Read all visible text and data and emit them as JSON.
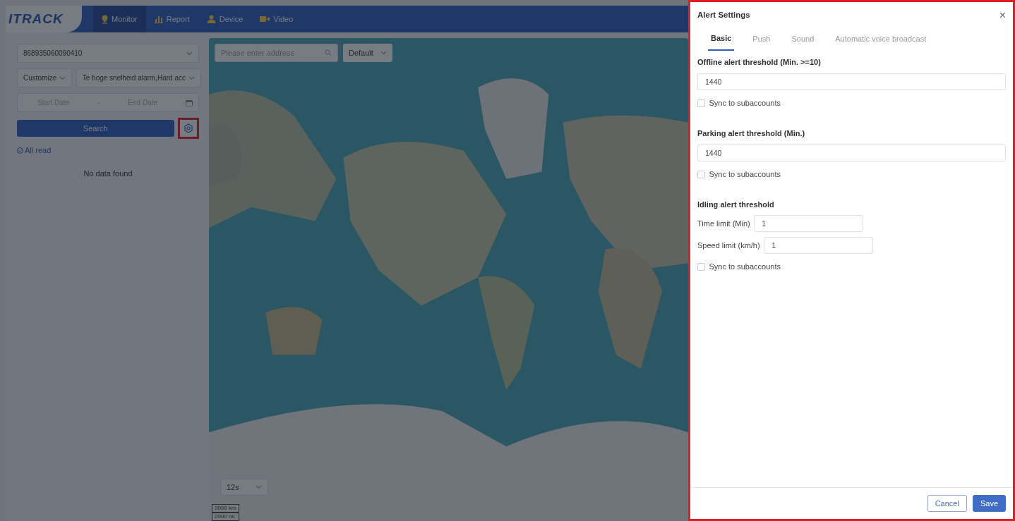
{
  "header": {
    "logo": "ITRACK",
    "nav": [
      {
        "label": "Monitor",
        "selected": true
      },
      {
        "label": "Report",
        "selected": false
      },
      {
        "label": "Device",
        "selected": false
      },
      {
        "label": "Video",
        "selected": false
      }
    ]
  },
  "sidebar": {
    "device": "868935060090410",
    "mode": "Customize",
    "alarm_types": "Te hoge snelheid alarm,Hard acc",
    "start_placeholder": "Start Date",
    "range_separator": "-",
    "end_placeholder": "End Date",
    "search_button": "Search",
    "all_read": "All read",
    "empty_text": "No data found"
  },
  "map": {
    "search_placeholder": "Please enter address",
    "layer": "Default",
    "interval": "12s",
    "scale": [
      "3000 km",
      "2000 mi"
    ]
  },
  "drawer": {
    "title": "Alert Settings",
    "close": "×",
    "tabs": [
      {
        "label": "Basic",
        "selected": true
      },
      {
        "label": "Push",
        "selected": false
      },
      {
        "label": "Sound",
        "selected": false
      },
      {
        "label": "Automatic voice broadcast",
        "selected": false
      }
    ],
    "sections": [
      {
        "kind": "field",
        "title": "Offline alert threshold (Min. >=10)",
        "value": "1440",
        "sync": {
          "label": "Sync to subaccounts",
          "checked": false
        }
      },
      {
        "kind": "field",
        "title": "Parking alert threshold (Min.)",
        "value": "1440",
        "sync": {
          "label": "Sync to subaccounts",
          "checked": false
        }
      },
      {
        "kind": "group",
        "title": "Idling alert threshold",
        "rows": [
          {
            "label": "Time limit (Min)",
            "value": "1"
          },
          {
            "label": "Speed limit (km/h)",
            "value": "1"
          }
        ],
        "sync": {
          "label": "Sync to subaccounts",
          "checked": false
        }
      }
    ],
    "buttons": [
      {
        "label": "Cancel",
        "kind": "secondary"
      },
      {
        "label": "Save",
        "kind": "primary"
      }
    ]
  }
}
